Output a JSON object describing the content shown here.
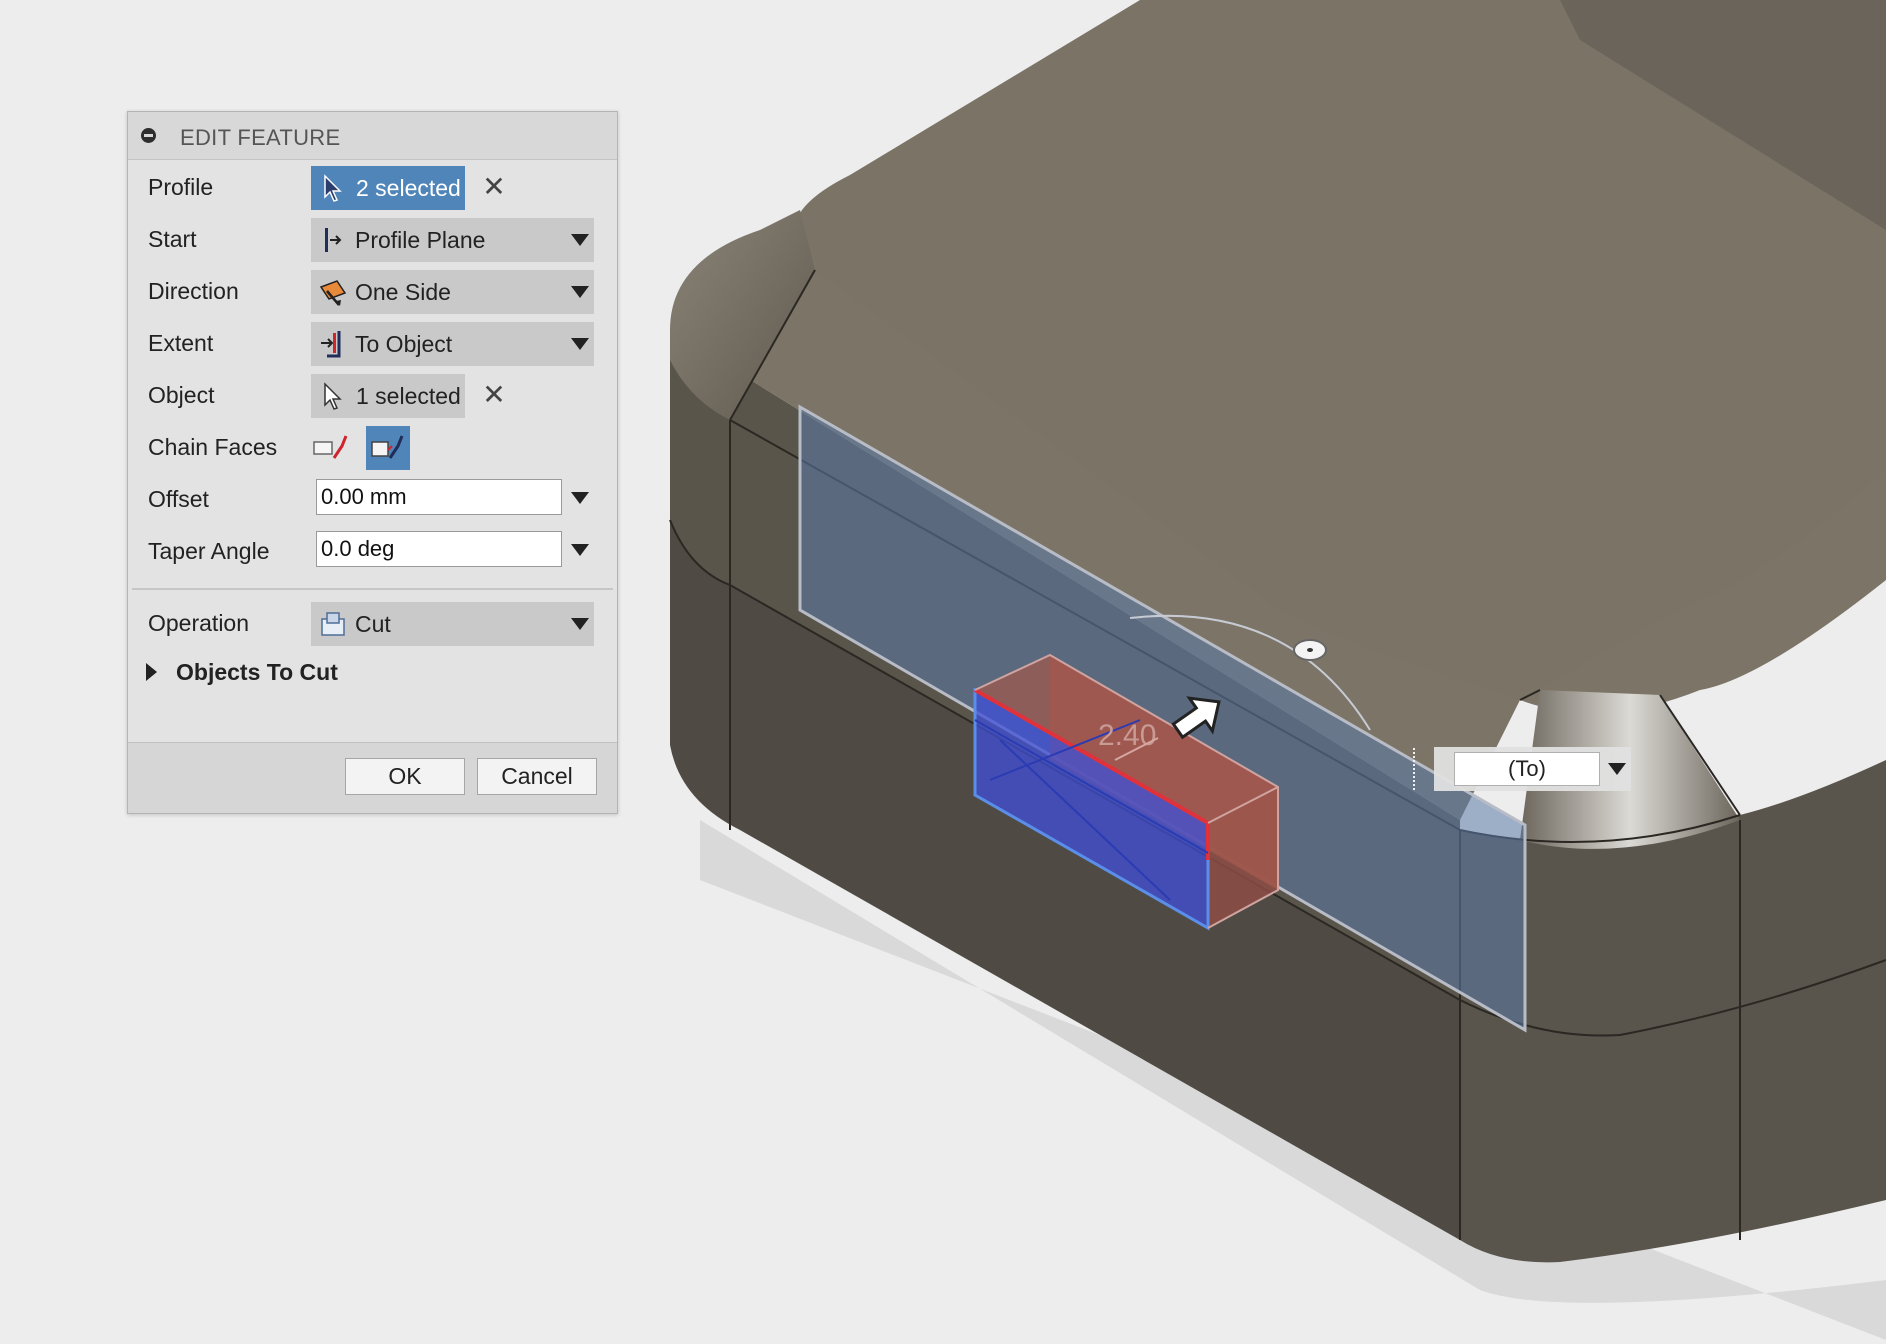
{
  "dialog": {
    "title": "EDIT FEATURE",
    "rows": {
      "profile": {
        "label": "Profile",
        "value": "2 selected"
      },
      "start": {
        "label": "Start",
        "value": "Profile Plane"
      },
      "direction": {
        "label": "Direction",
        "value": "One Side"
      },
      "extent": {
        "label": "Extent",
        "value": "To Object"
      },
      "object": {
        "label": "Object",
        "value": "1 selected"
      },
      "chain_faces": {
        "label": "Chain Faces"
      },
      "offset": {
        "label": "Offset",
        "value": "0.00 mm"
      },
      "taper_angle": {
        "label": "Taper Angle",
        "value": "0.0 deg"
      },
      "operation": {
        "label": "Operation",
        "value": "Cut"
      }
    },
    "objects_to_cut": "Objects To Cut",
    "buttons": {
      "ok": "OK",
      "cancel": "Cancel"
    }
  },
  "viewport": {
    "dimension_label": "2.40",
    "to_field": "(To)"
  },
  "colors": {
    "selection_blue": "#4f85b8",
    "model_top": "#7b7467",
    "model_side": "#555047",
    "plane_blue": "#5d7aa6",
    "cut_red": "#a85a4e",
    "profile_blue": "#3f55d6"
  },
  "icons": [
    "collapse-icon",
    "select-arrow-icon",
    "clear-x-icon",
    "profile-plane-icon",
    "one-side-icon",
    "to-object-icon",
    "chain-faces-off-icon",
    "chain-faces-on-icon",
    "cut-icon",
    "dropdown-arrow-icon",
    "move-arrow-icon"
  ]
}
